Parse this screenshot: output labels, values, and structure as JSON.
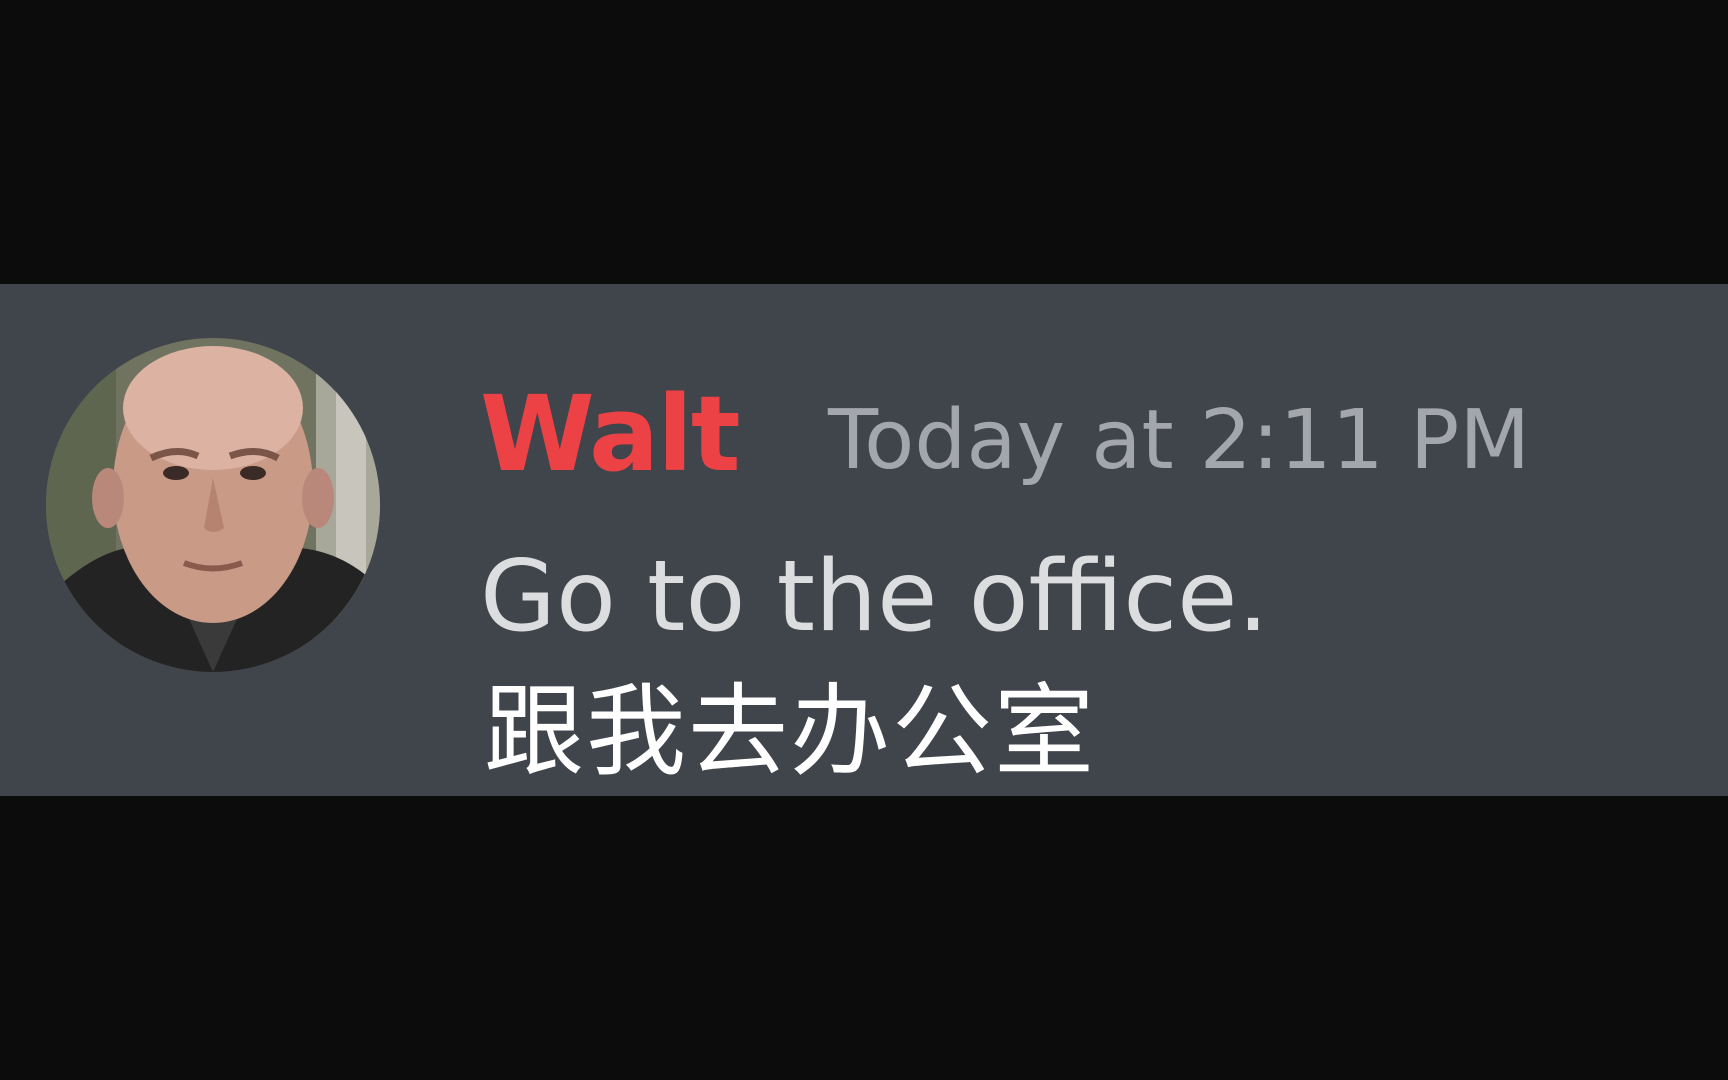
{
  "message": {
    "author": "Walt",
    "author_color": "#ed4245",
    "timestamp": "Today at 2:11 PM",
    "content": "Go to the office."
  },
  "subtitle": "跟我去办公室",
  "colors": {
    "background": "#0c0c0d",
    "message_background": "#40444b",
    "timestamp": "#a3a6aa",
    "content": "#dcddde"
  },
  "avatar": {
    "icon": "user-photo-avatar"
  }
}
